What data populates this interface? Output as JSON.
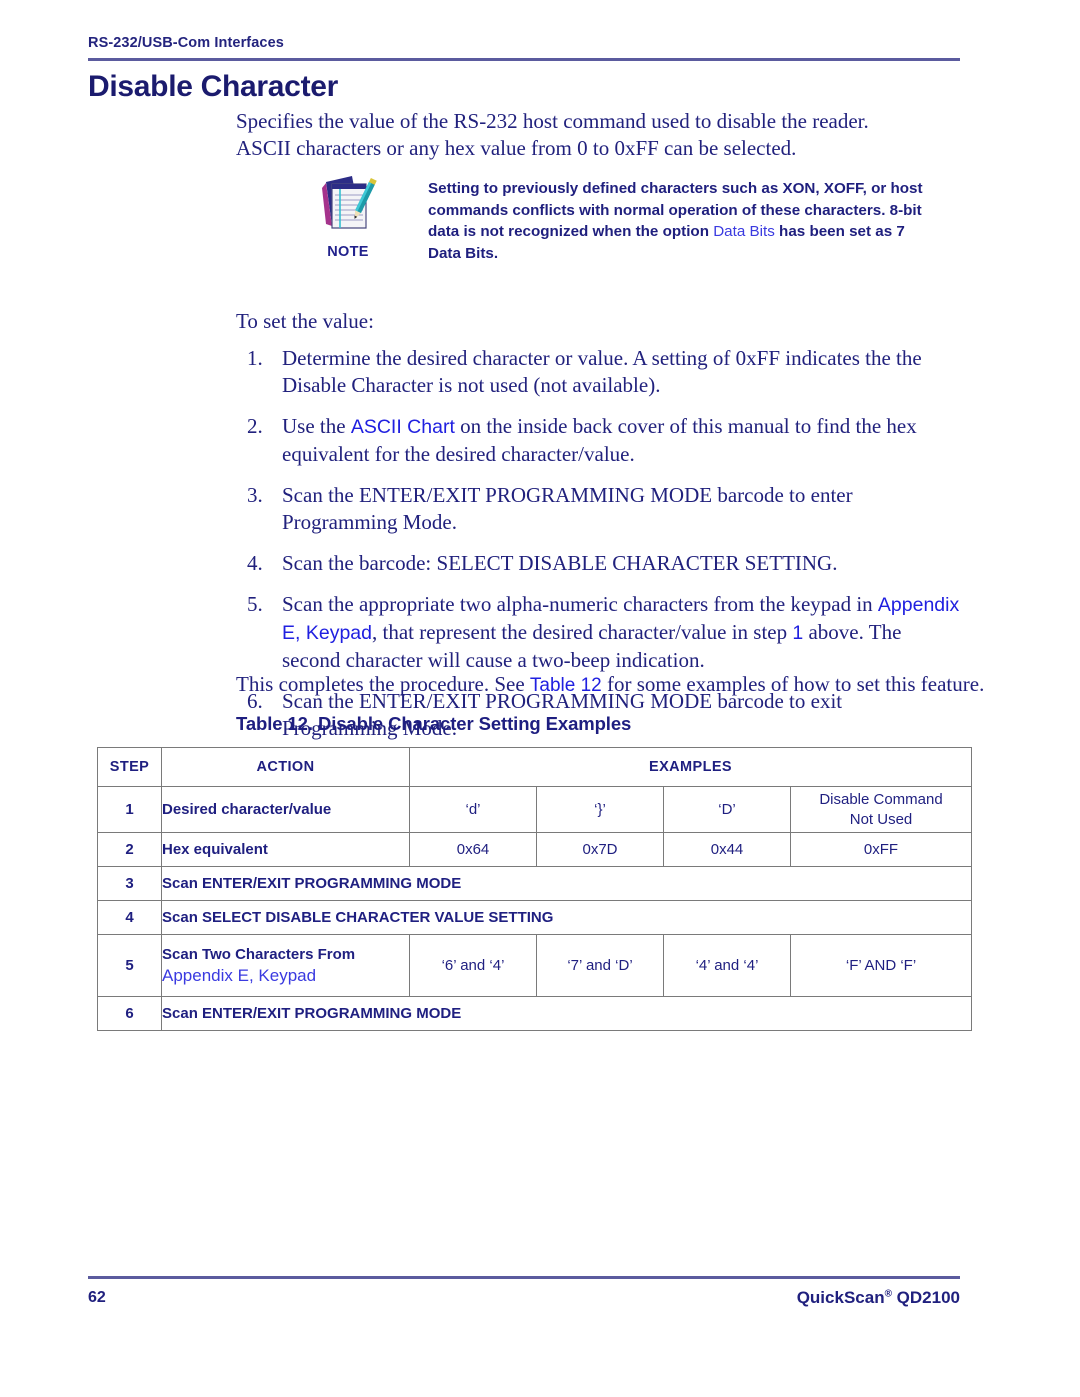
{
  "header": {
    "running_title": "RS-232/USB-Com Interfaces",
    "chapter_title": "Disable Character"
  },
  "intro": {
    "line1": "Specifies the value of the RS-232 host command used to disable the reader.",
    "line2": "ASCII characters or any hex value from 0 to 0xFF can be selected."
  },
  "note": {
    "label": "NOTE",
    "icon": "notepad-pencil-icon",
    "text_part1": "Setting to previously defined characters such as XON, XOFF, or host commands conflicts with normal operation of these characters. 8-bit data is not recognized when the option ",
    "link": "Data Bits",
    "text_part2": " has been set as 7 Data Bits."
  },
  "to_set_value": "To set the value:",
  "steps": [
    {
      "num": "1.",
      "text": "Determine the desired character or value. A setting of 0xFF indicates the the Disable Character is not used (not available)."
    },
    {
      "num": "2.",
      "pre": "Use the ",
      "link": "ASCII Chart",
      "post": " on the inside back cover of this manual to find the hex equivalent for the desired character/value."
    },
    {
      "num": "3.",
      "text": "Scan the ENTER/EXIT PROGRAMMING MODE barcode to enter Programming Mode."
    },
    {
      "num": "4.",
      "text": "Scan the barcode: SELECT DISABLE CHARACTER SETTING."
    },
    {
      "num": "5.",
      "pre": "Scan the appropriate two alpha-numeric characters from the keypad in ",
      "link": "Appendix E, Keypad",
      "mid": ", that represent the desired character/value in step ",
      "link2": "1",
      "post": " above. The second character will cause a two-beep indication."
    },
    {
      "num": "6.",
      "text": "Scan the ENTER/EXIT PROGRAMMING MODE barcode to exit Programming Mode."
    }
  ],
  "closing": {
    "pre": "This completes the procedure. See ",
    "link": "Table 12",
    "post": " for some examples of how to set this feature."
  },
  "table": {
    "caption": "Table 12. Disable Character Setting Examples",
    "headers": {
      "step": "STEP",
      "action": "ACTION",
      "examples": "EXAMPLES"
    },
    "rows": [
      {
        "step": "1",
        "action": "Desired character/value",
        "examples": [
          "‘d’",
          "‘}’",
          "‘D’",
          "Disable Command\nNot Used"
        ]
      },
      {
        "step": "2",
        "action": "Hex equivalent",
        "examples": [
          "0x64",
          "0x7D",
          "0x44",
          "0xFF"
        ]
      },
      {
        "step": "3",
        "action": "Scan ENTER/EXIT PROGRAMMING MODE",
        "span": true
      },
      {
        "step": "4",
        "action": "Scan SELECT DISABLE CHARACTER VALUE SETTING",
        "span": true
      },
      {
        "step": "5",
        "action": "Scan Two Characters From",
        "action_link": "Appendix E, Keypad",
        "examples": [
          "‘6’ and ‘4’",
          "‘7’ and ‘D’",
          "‘4’ and ‘4’",
          "‘F’ AND ‘F’"
        ]
      },
      {
        "step": "6",
        "action": "Scan ENTER/EXIT PROGRAMMING MODE",
        "span": true
      }
    ]
  },
  "footer": {
    "page_number": "62",
    "product": "QuickScan",
    "product_trademark": "®",
    "product_model": " QD2100"
  },
  "colors": {
    "body_navy": "#21217d",
    "link_blue": "#2020e0",
    "rule_purple": "#5b5b9e",
    "table_border": "#7a7a7a"
  }
}
